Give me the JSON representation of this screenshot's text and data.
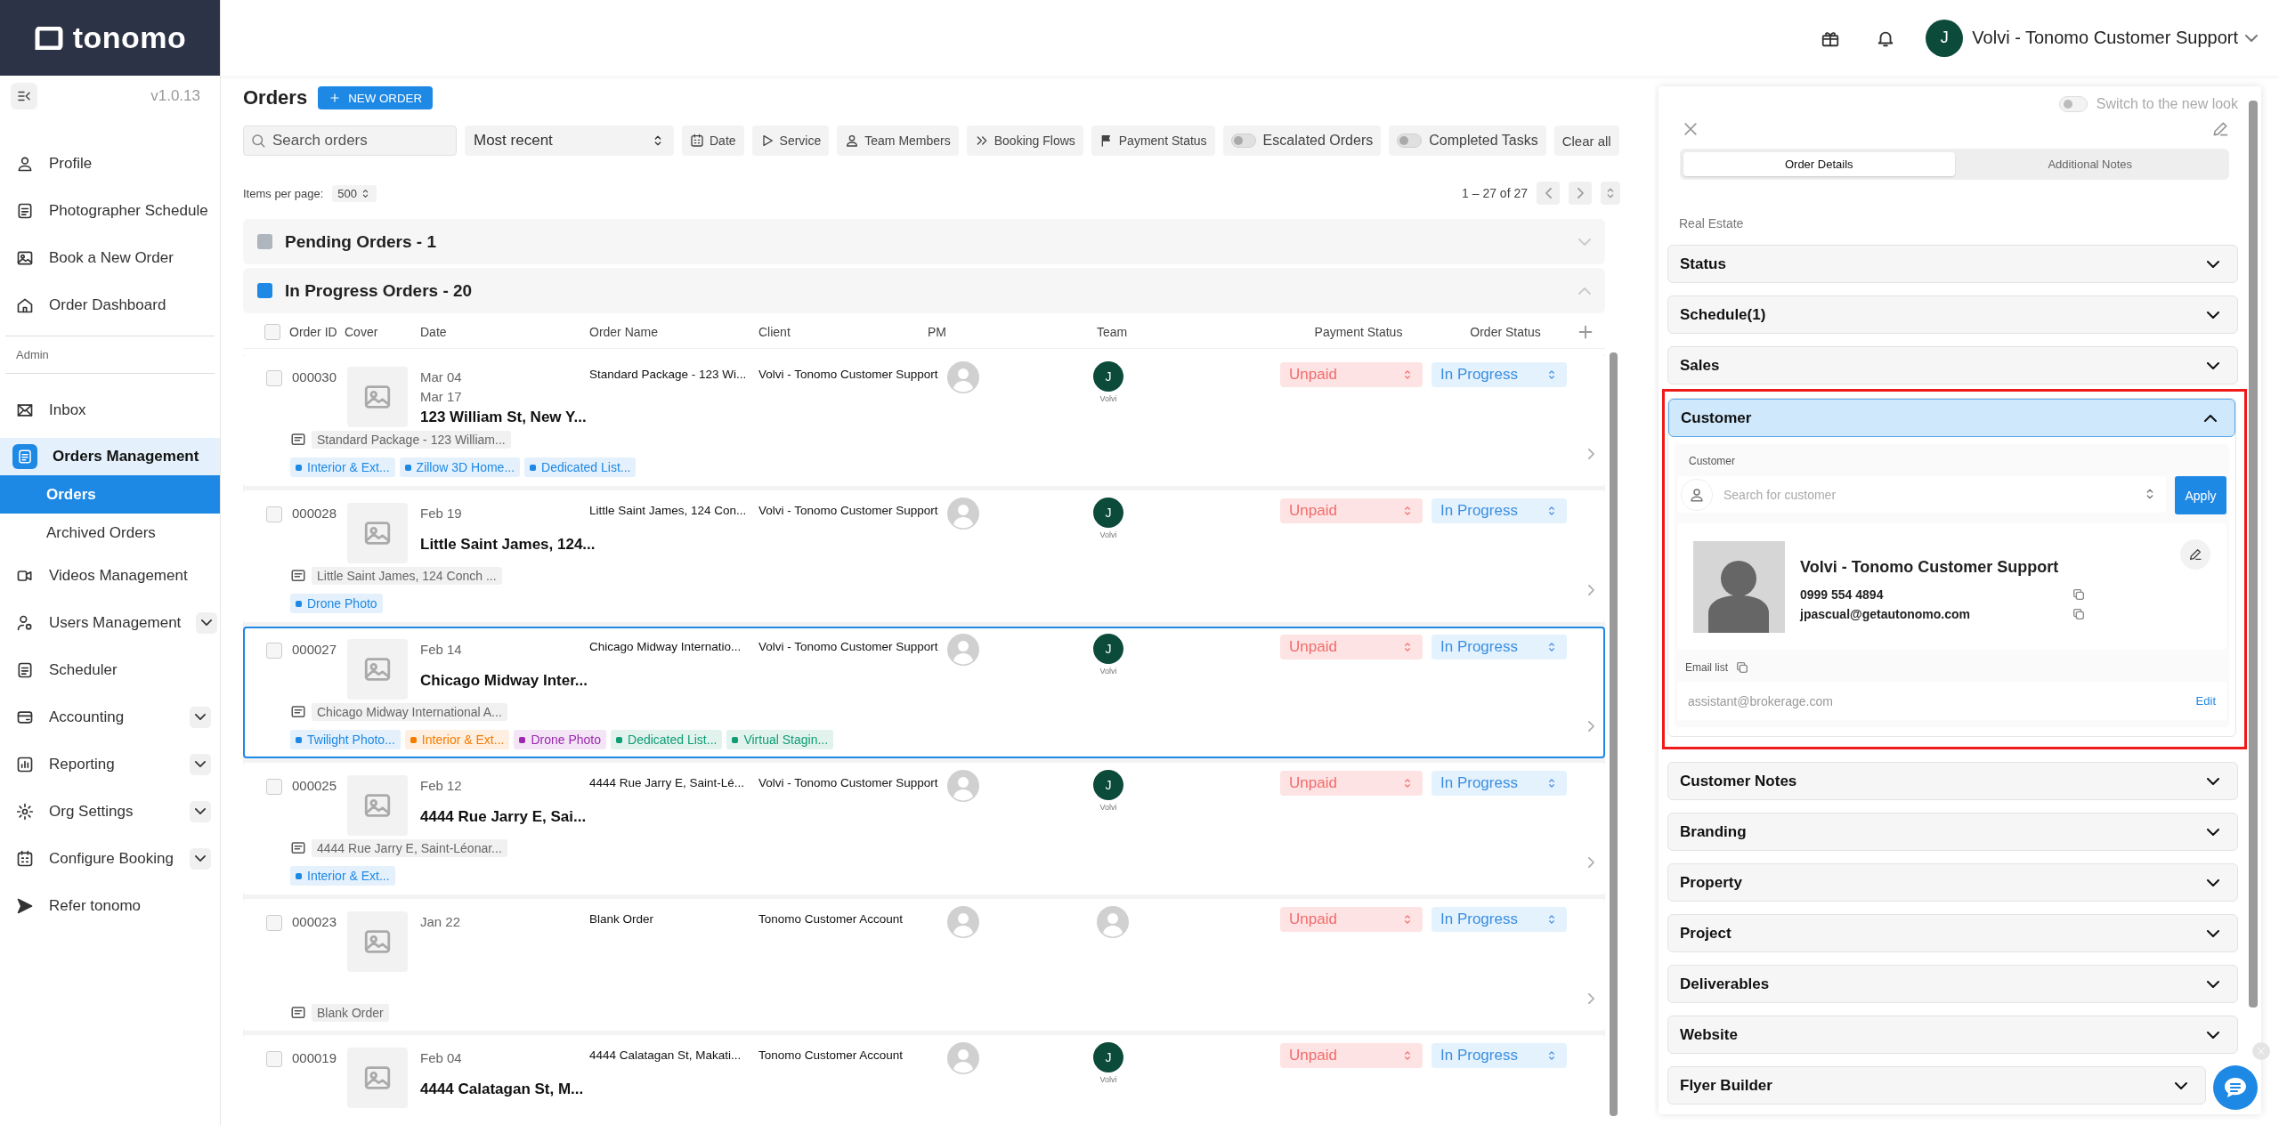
{
  "brand": {
    "name": "tonomo"
  },
  "header": {
    "user": {
      "initial": "J",
      "name": "Volvi - Tonomo Customer Support"
    }
  },
  "sidebar": {
    "version": "v1.0.13",
    "groups": [
      {
        "items": [
          {
            "kind": "link",
            "label": "Profile"
          },
          {
            "kind": "link",
            "label": "Photographer Schedule"
          },
          {
            "kind": "link",
            "label": "Book a New Order"
          },
          {
            "kind": "link",
            "label": "Order Dashboard"
          }
        ]
      },
      {
        "title": "Admin",
        "items": [
          {
            "kind": "link",
            "label": "Inbox"
          },
          {
            "kind": "group",
            "label": "Orders Management",
            "expanded": true,
            "children": [
              {
                "label": "Orders",
                "selected": true
              },
              {
                "label": "Archived Orders",
                "selected": false
              }
            ]
          },
          {
            "kind": "link",
            "label": "Videos Management"
          },
          {
            "kind": "group",
            "label": "Users Management",
            "expanded": false
          },
          {
            "kind": "link",
            "label": "Scheduler"
          },
          {
            "kind": "group",
            "label": "Accounting",
            "expanded": false
          },
          {
            "kind": "group",
            "label": "Reporting",
            "expanded": false
          },
          {
            "kind": "group",
            "label": "Org Settings",
            "expanded": false
          },
          {
            "kind": "group",
            "label": "Configure Booking",
            "expanded": false
          },
          {
            "kind": "link",
            "label": "Refer tonomo"
          }
        ]
      }
    ]
  },
  "orders": {
    "title": "Orders",
    "new_button": "NEW ORDER",
    "search": {
      "placeholder": "Search orders"
    },
    "sort": "Most recent",
    "filters": [
      {
        "label": "Date"
      },
      {
        "label": "Service"
      },
      {
        "label": "Team Members"
      },
      {
        "label": "Booking Flows"
      },
      {
        "label": "Payment Status"
      }
    ],
    "toggles": [
      {
        "label": "Escalated Orders",
        "on": false
      },
      {
        "label": "Completed Tasks",
        "on": false
      }
    ],
    "clear": "Clear all",
    "per_page_label": "Items per page:",
    "per_page": "500",
    "range": "1 – 27 of 27",
    "columns": [
      "Order ID",
      "Cover",
      "Date",
      "Order Name",
      "Client",
      "PM",
      "Team",
      "Payment Status",
      "Order Status"
    ],
    "groups": [
      {
        "title": "Pending Orders - 1",
        "color": "#aeb5bc",
        "expanded": false
      },
      {
        "title": "In Progress Orders - 20",
        "color": "#1e88e5",
        "expanded": true,
        "select_all": false,
        "rows": [
          {
            "id": "000030",
            "checked": false,
            "selected": false,
            "dates": [
              "Mar 04",
              "Mar 17"
            ],
            "title": "123 William St, New Y...",
            "order_name": "Standard Package - 123 Wi...",
            "client": "Volvi - Tonomo Customer Support",
            "team": {
              "initial": "J",
              "name": "Volvi"
            },
            "payment": "Unpaid",
            "status": "In Progress",
            "note": "Standard Package - 123 William...",
            "tags": [
              {
                "label": "Interior & Ext...",
                "color": "#1e88e5"
              },
              {
                "label": "Zillow 3D Home...",
                "color": "#1e88e5"
              },
              {
                "label": "Dedicated List...",
                "color": "#1e88e5"
              }
            ]
          },
          {
            "id": "000028",
            "checked": false,
            "selected": false,
            "dates": [
              "Feb 19"
            ],
            "title": "Little Saint James, 124...",
            "order_name": "Little Saint James, 124 Con...",
            "client": "Volvi - Tonomo Customer Support",
            "team": {
              "initial": "J",
              "name": "Volvi"
            },
            "payment": "Unpaid",
            "status": "In Progress",
            "note": "Little Saint James, 124 Conch ...",
            "tags": [
              {
                "label": "Drone Photo",
                "color": "#1e88e5"
              }
            ]
          },
          {
            "id": "000027",
            "checked": false,
            "selected": true,
            "dates": [
              "Feb 14"
            ],
            "title": "Chicago Midway Inter...",
            "order_name": "Chicago Midway Internatio...",
            "client": "Volvi - Tonomo Customer Support",
            "team": {
              "initial": "J",
              "name": "Volvi"
            },
            "payment": "Unpaid",
            "status": "In Progress",
            "note": "Chicago Midway International A...",
            "tags": [
              {
                "label": "Twilight Photo...",
                "color": "#1e88e5"
              },
              {
                "label": "Interior & Ext...",
                "color": "#f57c00"
              },
              {
                "label": "Drone Photo",
                "color": "#9c27b0"
              },
              {
                "label": "Dedicated List...",
                "color": "#0f9d74"
              },
              {
                "label": "Virtual Stagin...",
                "color": "#0f9d74"
              }
            ]
          },
          {
            "id": "000025",
            "checked": false,
            "selected": false,
            "dates": [
              "Feb 12"
            ],
            "title": "4444 Rue Jarry E, Sai...",
            "order_name": "4444 Rue Jarry E, Saint-Lé...",
            "client": "Volvi - Tonomo Customer Support",
            "team": {
              "initial": "J",
              "name": "Volvi"
            },
            "payment": "Unpaid",
            "status": "In Progress",
            "note": "4444 Rue Jarry E, Saint-Léonar...",
            "tags": [
              {
                "label": "Interior & Ext...",
                "color": "#1e88e5"
              }
            ]
          },
          {
            "id": "000023",
            "checked": false,
            "selected": false,
            "dates": [
              "Jan 22"
            ],
            "order_name": "Blank Order",
            "client": "Tonomo Customer Account",
            "payment": "Unpaid",
            "status": "In Progress",
            "note": "Blank Order"
          },
          {
            "id": "000019",
            "checked": false,
            "selected": false,
            "dates": [
              "Feb 04"
            ],
            "title": "4444 Calatagan St, M...",
            "order_name": "4444 Calatagan St, Makati...",
            "client": "Tonomo Customer Account",
            "team": {
              "initial": "J",
              "name": "Volvi"
            },
            "payment": "Unpaid",
            "status": "In Progress"
          }
        ]
      }
    ]
  },
  "panel": {
    "toggle": {
      "label": "Switch to the new look",
      "on": false
    },
    "tabs": [
      {
        "label": "Order Details",
        "selected": true
      },
      {
        "label": "Additional Notes",
        "selected": false
      }
    ],
    "category": "Real Estate",
    "sections": [
      {
        "title": "Status",
        "expanded": false,
        "highlighted": false
      },
      {
        "title": "Schedule(1)",
        "expanded": false,
        "highlighted": false
      },
      {
        "title": "Sales",
        "expanded": false,
        "highlighted": false
      },
      {
        "title": "Customer",
        "expanded": true,
        "highlighted": true,
        "customer": {
          "label": "Customer",
          "search_placeholder": "Search for customer",
          "apply": "Apply",
          "name": "Volvi - Tonomo Customer Support",
          "phone": "0999 554 4894",
          "email": "jpascual@getautonomo.com",
          "email_list_label": "Email list",
          "email_list": "assistant@brokerage.com",
          "edit": "Edit"
        }
      },
      {
        "title": "Customer Notes",
        "expanded": false,
        "highlighted": false
      },
      {
        "title": "Branding",
        "expanded": false,
        "highlighted": false
      },
      {
        "title": "Property",
        "expanded": false,
        "highlighted": false
      },
      {
        "title": "Project",
        "expanded": false,
        "highlighted": false
      },
      {
        "title": "Deliverables",
        "expanded": false,
        "highlighted": false
      },
      {
        "title": "Website",
        "expanded": false,
        "highlighted": false
      },
      {
        "title": "Flyer Builder",
        "expanded": false,
        "highlighted": false
      }
    ]
  }
}
